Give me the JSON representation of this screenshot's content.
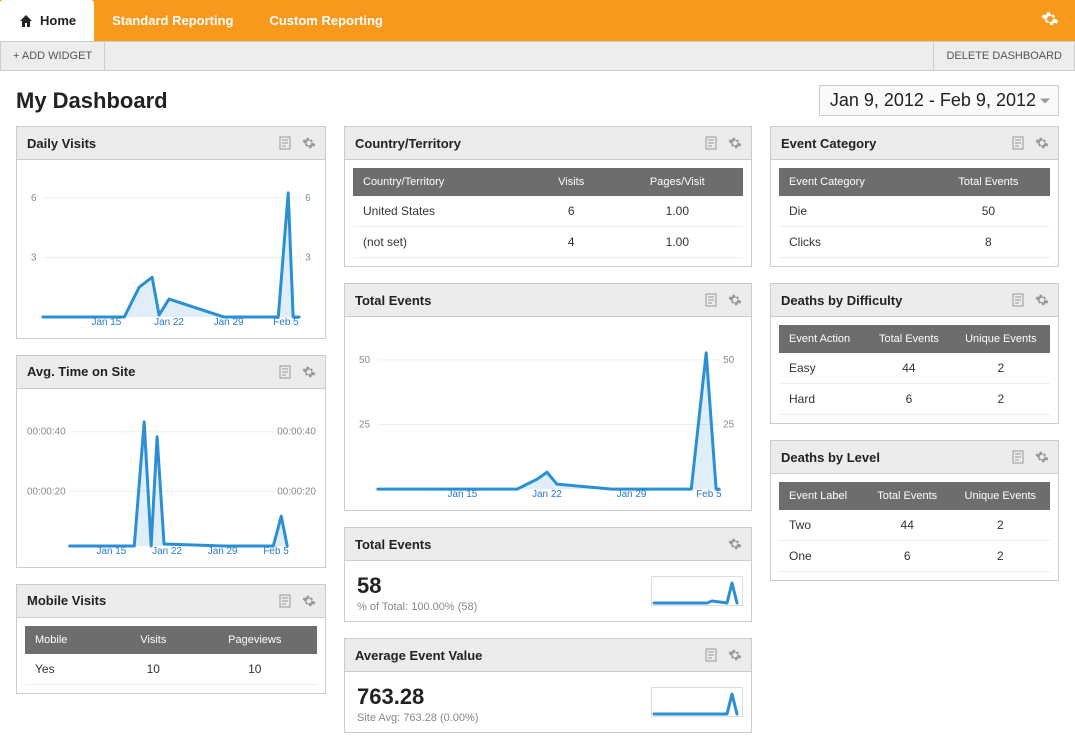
{
  "topbar": {
    "tabs": [
      {
        "label": "Home",
        "active": true
      },
      {
        "label": "Standard Reporting",
        "active": false
      },
      {
        "label": "Custom Reporting",
        "active": false
      }
    ]
  },
  "action_bar": {
    "add_widget": "+ ADD WIDGET",
    "delete_dashboard": "DELETE DASHBOARD"
  },
  "page_title": "My Dashboard",
  "date_range": "Jan 9, 2012 - Feb 9, 2012",
  "widgets": {
    "daily_visits": {
      "title": "Daily Visits",
      "y_left": [
        "6",
        "3"
      ],
      "y_right": [
        "6",
        "3"
      ],
      "x": [
        "Jan 15",
        "Jan 22",
        "Jan 29",
        "Feb 5"
      ]
    },
    "avg_time": {
      "title": "Avg. Time on Site",
      "y_left": [
        "00:00:40",
        "00:00:20"
      ],
      "y_right": [
        "00:00:40",
        "00:00:20"
      ],
      "x": [
        "Jan 15",
        "Jan 22",
        "Jan 29",
        "Feb 5"
      ]
    },
    "mobile_visits": {
      "title": "Mobile Visits",
      "headers": [
        "Mobile",
        "Visits",
        "Pageviews"
      ],
      "rows": [
        [
          "Yes",
          "10",
          "10"
        ]
      ]
    },
    "country": {
      "title": "Country/Territory",
      "headers": [
        "Country/Territory",
        "Visits",
        "Pages/Visit"
      ],
      "rows": [
        [
          "United States",
          "6",
          "1.00"
        ],
        [
          "(not set)",
          "4",
          "1.00"
        ]
      ]
    },
    "total_events_chart": {
      "title": "Total Events",
      "y_left": [
        "50",
        "25"
      ],
      "y_right": [
        "50",
        "25"
      ],
      "x": [
        "Jan 15",
        "Jan 22",
        "Jan 29",
        "Feb 5"
      ]
    },
    "total_events_stat": {
      "title": "Total Events",
      "value": "58",
      "sub": "% of Total: 100.00% (58)"
    },
    "avg_event_value": {
      "title": "Average Event Value",
      "value": "763.28",
      "sub": "Site Avg: 763.28 (0.00%)"
    },
    "event_category": {
      "title": "Event Category",
      "headers": [
        "Event Category",
        "Total Events"
      ],
      "rows": [
        [
          "Die",
          "50"
        ],
        [
          "Clicks",
          "8"
        ]
      ]
    },
    "deaths_difficulty": {
      "title": "Deaths by Difficulty",
      "headers": [
        "Event Action",
        "Total Events",
        "Unique Events"
      ],
      "rows": [
        [
          "Easy",
          "44",
          "2"
        ],
        [
          "Hard",
          "6",
          "2"
        ]
      ]
    },
    "deaths_level": {
      "title": "Deaths by Level",
      "headers": [
        "Event Label",
        "Total Events",
        "Unique Events"
      ],
      "rows": [
        [
          "Two",
          "44",
          "2"
        ],
        [
          "One",
          "6",
          "2"
        ]
      ]
    }
  },
  "chart_data": [
    {
      "name": "daily_visits",
      "type": "line",
      "x": [
        "Jan 9",
        "Jan 15",
        "Jan 22",
        "Jan 29",
        "Feb 5",
        "Feb 9"
      ],
      "values": [
        0,
        0,
        2,
        0,
        0,
        6.5,
        0
      ],
      "ylim": [
        0,
        6.5
      ]
    },
    {
      "name": "avg_time",
      "type": "line",
      "x": [
        "Jan 9",
        "Jan 15",
        "Jan 22",
        "Jan 29",
        "Feb 5",
        "Feb 9"
      ],
      "values_seconds": [
        0,
        0,
        46,
        0,
        0,
        10,
        0
      ],
      "ylim": [
        0,
        46
      ]
    },
    {
      "name": "total_events_chart",
      "type": "line",
      "x": [
        "Jan 9",
        "Jan 15",
        "Jan 22",
        "Jan 29",
        "Feb 5",
        "Feb 9"
      ],
      "values": [
        0,
        0,
        0,
        5,
        0,
        0,
        53,
        0
      ],
      "ylim": [
        0,
        53
      ]
    }
  ]
}
